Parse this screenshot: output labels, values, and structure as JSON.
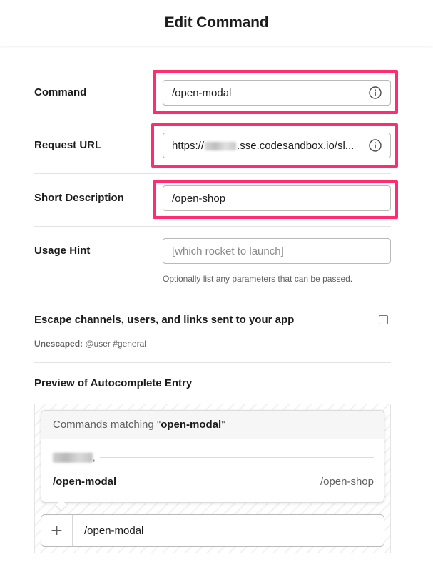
{
  "header": {
    "title": "Edit Command"
  },
  "form": {
    "command": {
      "label": "Command",
      "value": "/open-modal"
    },
    "request_url": {
      "label": "Request URL",
      "value_prefix": "https://",
      "value_suffix": ".sse.codesandbox.io/sl..."
    },
    "short_description": {
      "label": "Short Description",
      "value": "/open-shop"
    },
    "usage_hint": {
      "label": "Usage Hint",
      "placeholder": "[which rocket to launch]",
      "helper": "Optionally list any parameters that can be passed."
    },
    "escape": {
      "label": "Escape channels, users, and links sent to your app",
      "checked": false,
      "unescaped_label": "Unescaped:",
      "unescaped_example": "@user #general"
    }
  },
  "preview": {
    "title": "Preview of Autocomplete Entry",
    "matching_prefix": "Commands matching \"",
    "matching_term": "open-modal",
    "matching_suffix": "\"",
    "app_separator": ",",
    "command_name": "/open-modal",
    "command_description": "/open-shop",
    "composer_plus": "+",
    "composer_text": "/open-modal"
  },
  "colors": {
    "highlight": "#ff2d6f",
    "text": "#1d1c1d",
    "muted": "#616061"
  },
  "icons": {
    "info": "info-circle-icon",
    "plus": "plus-icon"
  }
}
